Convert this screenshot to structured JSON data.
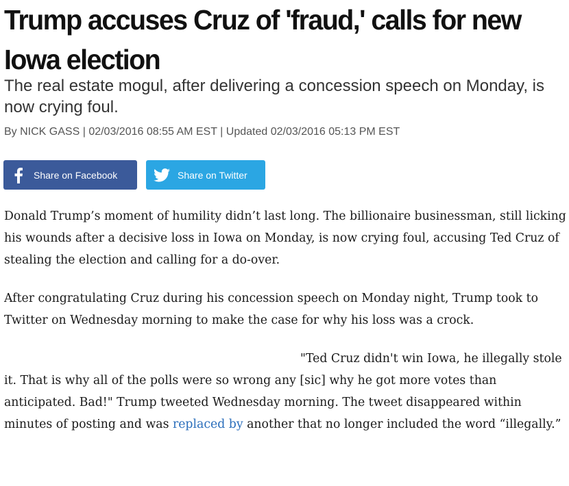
{
  "article": {
    "headline": "Trump accuses Cruz of 'fraud,' calls for new Iowa election",
    "subheadline": "The real estate mogul, after delivering a concession speech on Monday, is now crying foul.",
    "byline": {
      "prefix": "By ",
      "author": "NICK GASS",
      "separator": " | ",
      "published": "02/03/2016 08:55 AM EST",
      "updated_prefix": "Updated ",
      "updated": "02/03/2016 05:13 PM EST"
    }
  },
  "share": {
    "facebook_label": "Share on Facebook",
    "twitter_label": "Share on Twitter",
    "facebook_color": "#3b5a9a",
    "twitter_color": "#2ba6e3",
    "facebook_icon": "facebook-f-icon",
    "twitter_icon": "twitter-bird-icon"
  },
  "body": {
    "paragraph1": "Donald Trump’s moment of humility didn’t last long. The billionaire businessman, still licking his wounds after a decisive loss in Iowa on Monday, is now crying foul, accusing Ted Cruz of stealing the election and calling for a do-over.",
    "paragraph2": "After congratulating Cruz during his concession speech on Monday night, Trump took to Twitter on Wednesday morning to make the case for why his loss was a crock.",
    "paragraph3_before_link": "\"Ted Cruz didn't win Iowa, he illegally stole it. That is why all of the polls were so wrong any [sic] why he got more votes than anticipated. Bad!\" Trump tweeted Wednesday morning. The tweet disappeared within minutes of posting and was ",
    "paragraph3_link": "replaced by",
    "paragraph3_after_link": " another that no longer included the word “illegally.”",
    "link_color": "#2a6ebb"
  }
}
